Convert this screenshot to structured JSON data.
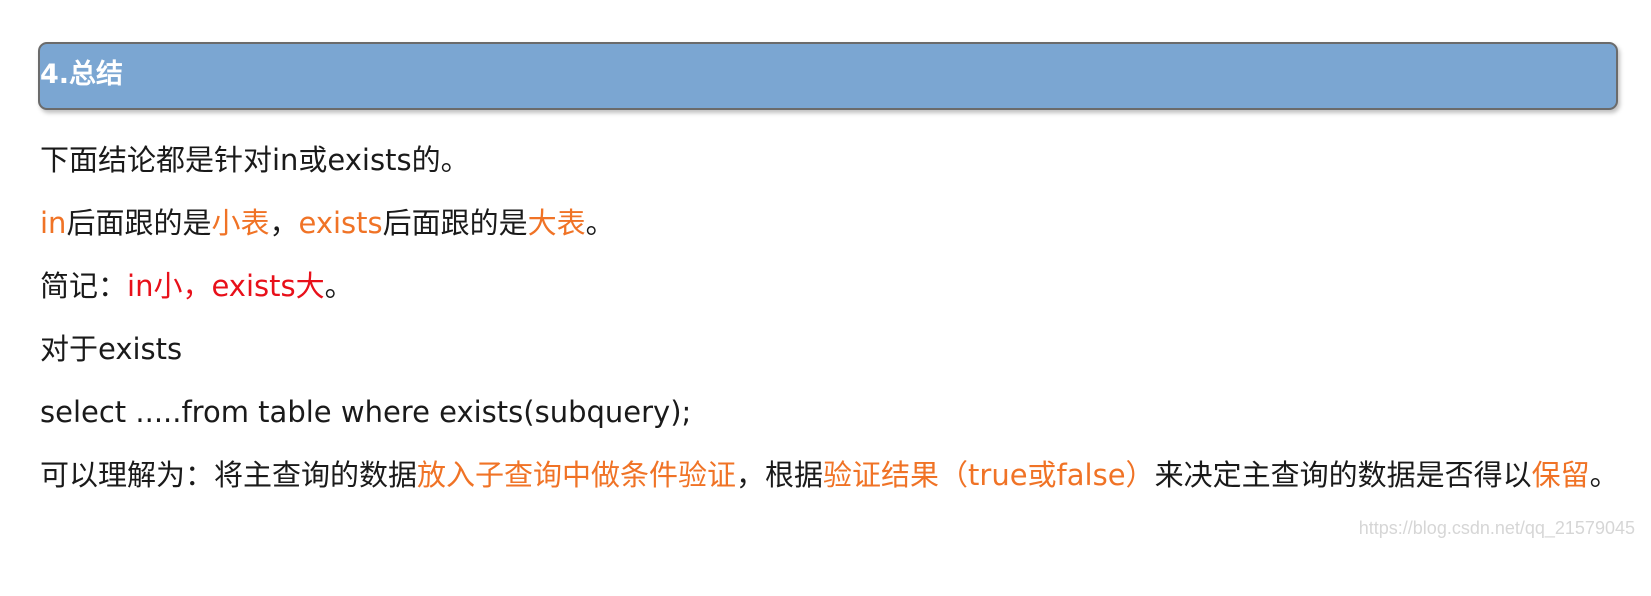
{
  "section": {
    "title": "4.总结"
  },
  "paragraphs": {
    "p1": "下面结论都是针对in或exists的。",
    "p2": {
      "s1": "in",
      "s2": "后面跟的是",
      "s3": "小表",
      "s4": "，",
      "s5": "exists",
      "s6": "后面跟的是",
      "s7": "大表",
      "s8": "。"
    },
    "p3": {
      "s1": "简记：",
      "s2": "in小，exists大",
      "s3": "。"
    },
    "p4": "对于exists",
    "p5": "select .....from table where exists(subquery);",
    "p6": {
      "s1": "可以理解为：将主查询的数据",
      "s2": "放入子查询中做条件验证",
      "s3": "，根据",
      "s4": "验证结果（true或false）",
      "s5": "来决定主查询的数据是否得以",
      "s6": "保留",
      "s7": "。"
    }
  },
  "watermark": "https://blog.csdn.net/qq_21579045",
  "colors": {
    "header_bg": "#7ba6d2",
    "highlight_orange": "#f07326",
    "highlight_red": "#e8101a"
  }
}
